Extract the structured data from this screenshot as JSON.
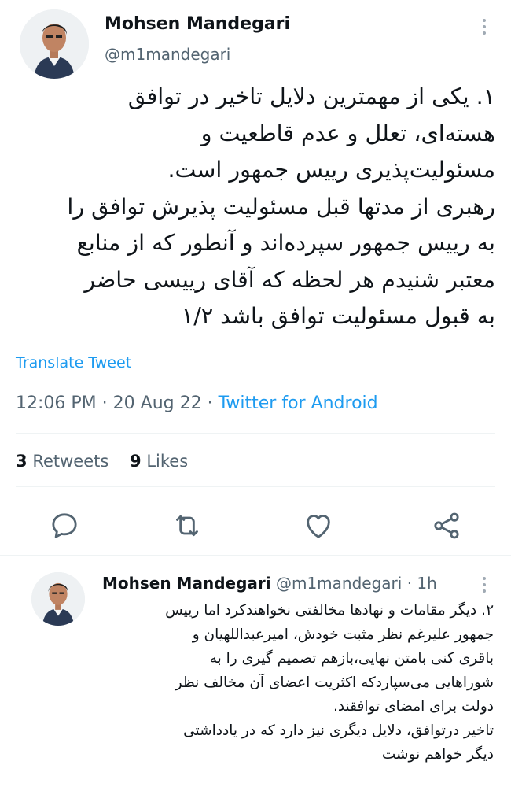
{
  "main_tweet": {
    "author_name": "Mohsen Mandegari",
    "author_handle": "@m1mandegari",
    "text": "۱. یکی از مهمترین دلایل تاخیر در توافق\nهسته‌ای، تعلل و عدم قاطعیت و\nمسئولیت‌پذیری رییس جمهور است.\nرهبری از مدتها قبل مسئولیت پذیرش توافق را\nبه رییس جمهور سپرده‌اند و آنطور که از منابع\nمعتبر شنیدم هر لحظه که آقای رییسی حاضر\nبه قبول مسئولیت توافق باشد ۱/۲",
    "translate_label": "Translate Tweet",
    "time": "12:06 PM",
    "date": "20 Aug 22",
    "source": "Twitter for Android",
    "retweets_count": "3",
    "retweets_label": "Retweets",
    "likes_count": "9",
    "likes_label": "Likes",
    "icons": {
      "more": "more-vertical-icon",
      "reply": "reply-icon",
      "retweet": "retweet-icon",
      "like": "heart-icon",
      "share": "share-icon"
    }
  },
  "reply_tweet": {
    "author_name": "Mohsen Mandegari",
    "author_handle": "@m1mandegari",
    "age": "1h",
    "text": "۲. دیگر مقامات و نهادها مخالفتی نخواهندکرد اما رییس\nجمهور علیرغم نظر مثبت خودش، امیرعبداللهیان و\nباقری کنی بامتن نهایی،بازهم تصمیم گیری را به\nشوراهایی می‌سپاردکه اکثریت اعضای آن مخالف نظر\nدولت برای امضای توافقند.\nتاخیر درتوافق، دلایل دیگری نیز دارد که در یادداشتی\nدیگر خواهم نوشت"
  },
  "colors": {
    "text": "#0f1419",
    "secondary": "#536471",
    "link": "#1d9bf0",
    "divider": "#eff3f4"
  }
}
